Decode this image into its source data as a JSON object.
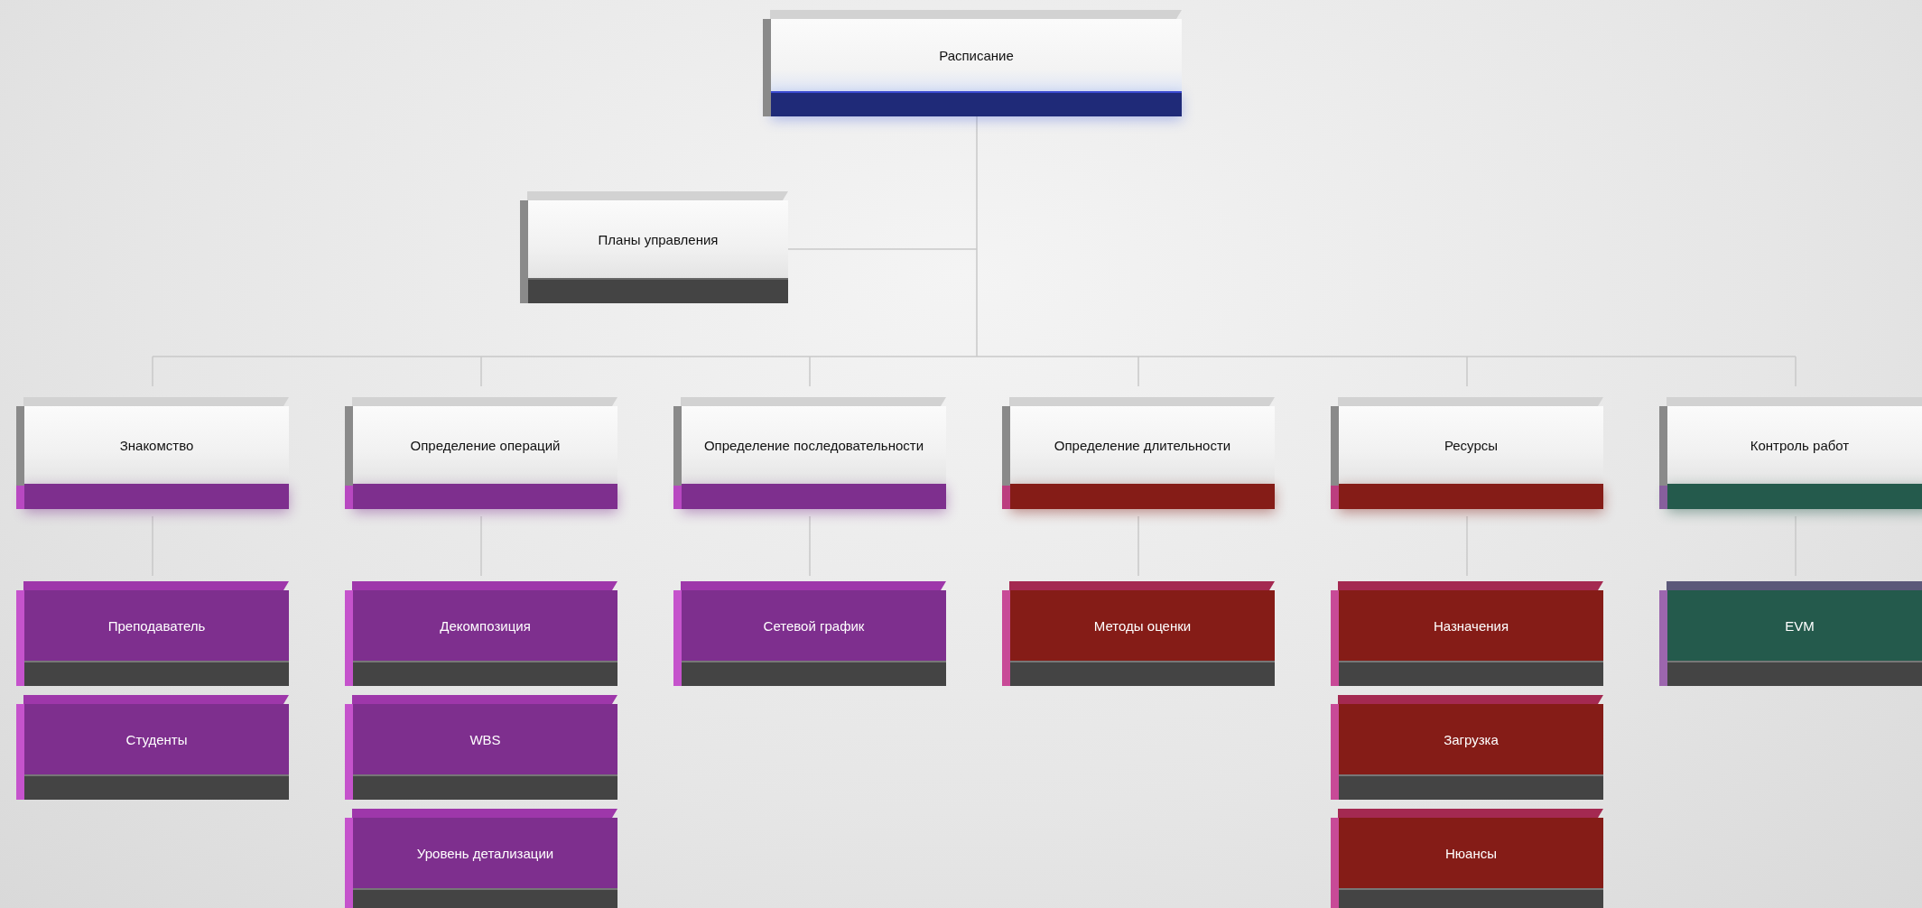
{
  "root": {
    "label": "Расписание"
  },
  "management_plans": {
    "label": "Планы управления"
  },
  "branches": [
    {
      "label": "Знакомство",
      "color": "#7e2f8e",
      "children": [
        {
          "label": "Преподаватель"
        },
        {
          "label": "Студенты"
        }
      ]
    },
    {
      "label": "Определение операций",
      "color": "#7e2f8e",
      "children": [
        {
          "label": "Декомпозиция"
        },
        {
          "label": "WBS"
        },
        {
          "label": "Уровень детализации"
        }
      ]
    },
    {
      "label": "Определение последовательности",
      "color": "#7e2f8e",
      "children": [
        {
          "label": "Сетевой график"
        }
      ]
    },
    {
      "label": "Определение длительности",
      "color": "#851c17",
      "children": [
        {
          "label": "Методы оценки"
        }
      ]
    },
    {
      "label": "Ресурсы",
      "color": "#851c17",
      "children": [
        {
          "label": "Назначения"
        },
        {
          "label": "Загрузка"
        },
        {
          "label": "Нюансы"
        }
      ]
    },
    {
      "label": "Контроль работ",
      "color": "#245a4c",
      "children": [
        {
          "label": "EVM"
        }
      ]
    }
  ]
}
